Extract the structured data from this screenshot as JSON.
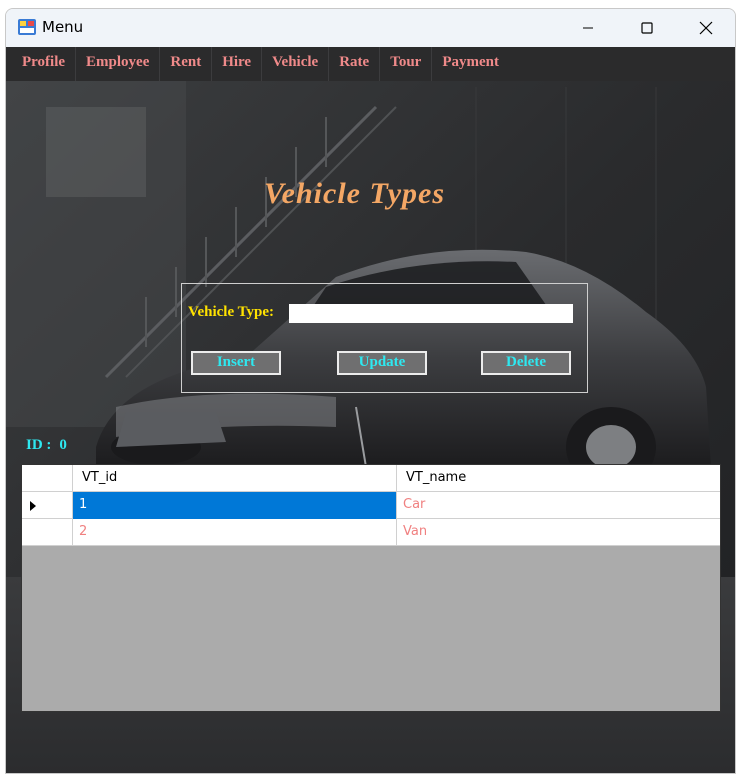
{
  "window": {
    "title": "Menu"
  },
  "menu": [
    "Profile",
    "Employee",
    "Rent",
    "Hire",
    "Vehicle",
    "Rate",
    "Tour",
    "Payment"
  ],
  "heading": "Vehicle Types",
  "form": {
    "vehicle_type_label": "Vehicle Type:",
    "vehicle_type_value": "",
    "insert_label": "Insert",
    "update_label": "Update",
    "delete_label": "Delete"
  },
  "id_label": "ID :",
  "id_value": "0",
  "grid": {
    "columns": [
      "VT_id",
      "VT_name"
    ],
    "rows": [
      {
        "id": "1",
        "name": "Car"
      },
      {
        "id": "2",
        "name": "Van"
      }
    ]
  },
  "colors": {
    "menu_text": "#f08a8a",
    "heading": "#f4a765",
    "label_yellow": "#ffe200",
    "button_text": "#2ee8f0",
    "selection": "#0078d7"
  }
}
